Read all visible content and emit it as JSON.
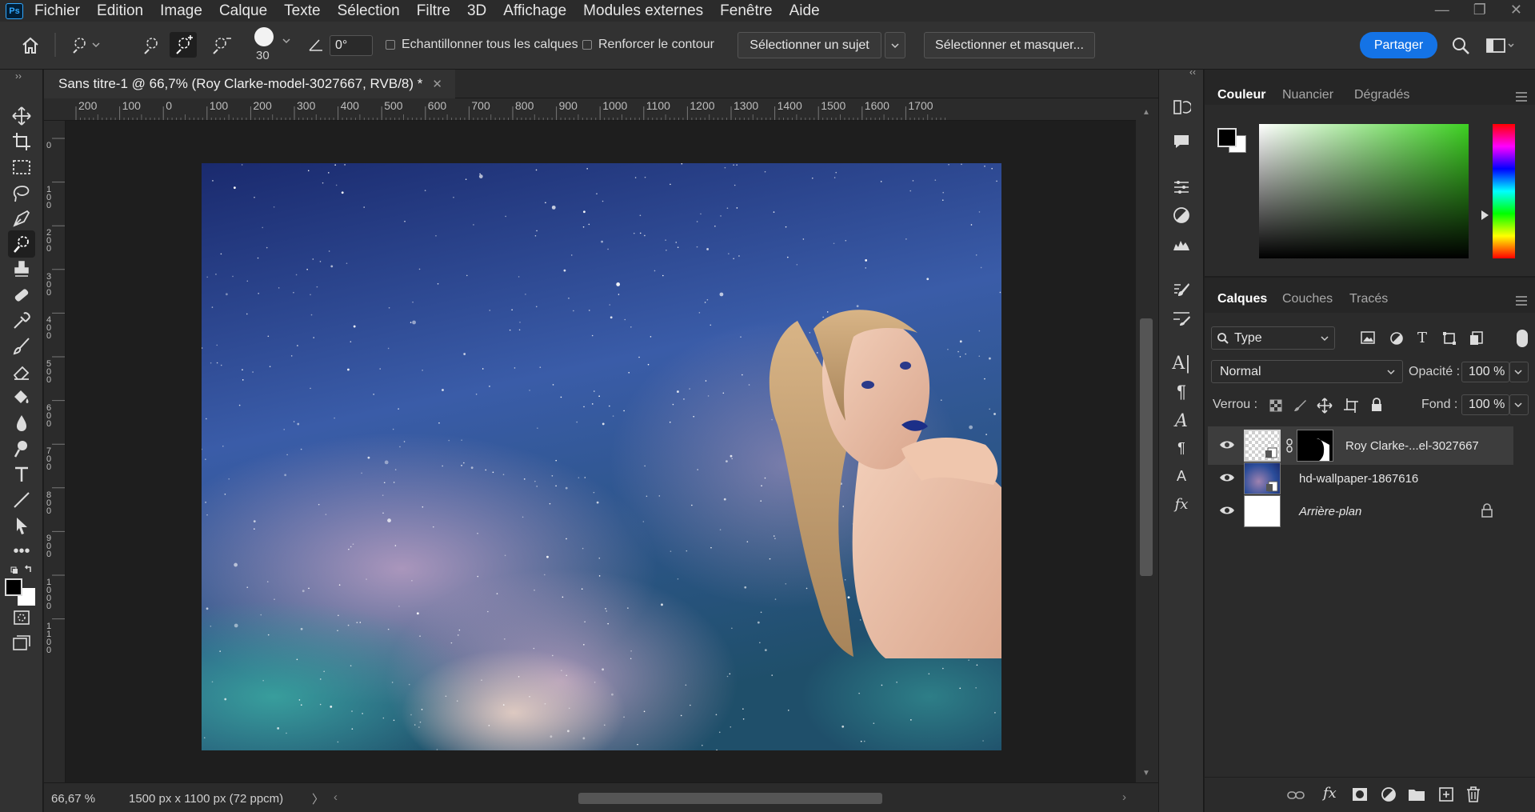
{
  "app": {
    "logo": "Ps"
  },
  "menu": [
    "Fichier",
    "Edition",
    "Image",
    "Calque",
    "Texte",
    "Sélection",
    "Filtre",
    "3D",
    "Affichage",
    "Modules externes",
    "Fenêtre",
    "Aide"
  ],
  "options": {
    "brush_size": "30",
    "angle_value": "0°",
    "sample_all_layers": "Echantillonner tous les calques",
    "enhance_edge": "Renforcer le contour",
    "select_subject": "Sélectionner un sujet",
    "select_and_mask": "Sélectionner et masquer...",
    "share": "Partager"
  },
  "document": {
    "tab_title": "Sans titre-1 @ 66,7% (Roy Clarke-model-3027667, RVB/8) *"
  },
  "rulers": {
    "horizontal": [
      "200",
      "100",
      "0",
      "100",
      "200",
      "300",
      "400",
      "500",
      "600",
      "700",
      "800",
      "900",
      "1000",
      "1100",
      "1200",
      "1300",
      "1400",
      "1500",
      "1600",
      "1700"
    ],
    "vertical": [
      "0",
      "0",
      "100",
      "200",
      "300",
      "400",
      "500",
      "600",
      "700",
      "800",
      "900",
      "1000",
      "1100"
    ]
  },
  "status": {
    "zoom": "66,67 %",
    "doc_info": "1500 px x 1100 px (72 ppcm)"
  },
  "color_panel": {
    "tabs": [
      "Couleur",
      "Nuancier",
      "Dégradés"
    ],
    "active": "Couleur",
    "accent_green": "#3dd022"
  },
  "layers_panel": {
    "tabs": [
      "Calques",
      "Couches",
      "Tracés"
    ],
    "active": "Calques",
    "filter": "Type",
    "blend_mode": "Normal",
    "opacity_label": "Opacité :",
    "opacity_value": "100 %",
    "lock_label": "Verrou :",
    "fill_label": "Fond :",
    "fill_value": "100 %",
    "layers": [
      {
        "name": "Roy Clarke-...el-3027667",
        "selected": true
      },
      {
        "name": "hd-wallpaper-1867616",
        "selected": false
      },
      {
        "name": "Arrière-plan",
        "selected": false,
        "locked": true
      }
    ]
  }
}
